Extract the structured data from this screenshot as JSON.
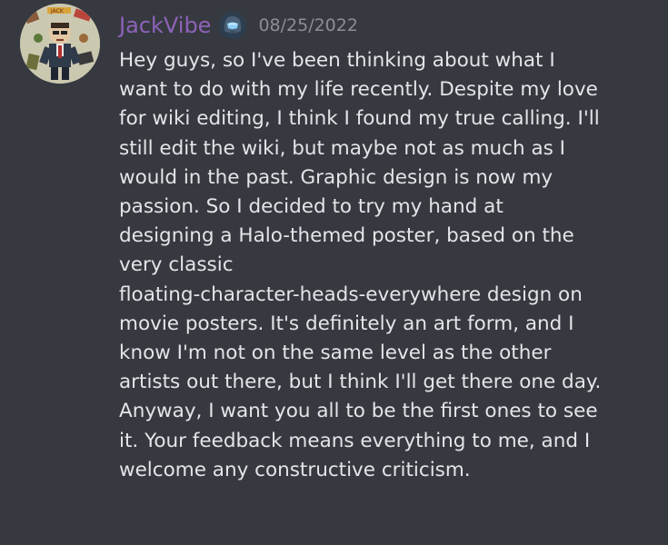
{
  "message": {
    "author": "JackVibe",
    "timestamp": "08/25/2022",
    "role_icon": "helmet-badge-icon",
    "colors": {
      "background": "#36393f",
      "username": "#8e62b8",
      "timestamp": "#8b8e93",
      "text": "#e3e5e8"
    },
    "lines": [
      "Hey guys, so I've been thinking about what I",
      "want to do with my life recently. Despite my love",
      "for wiki editing, I think I found my true calling. I'll",
      "still edit the wiki, but maybe not as much as I",
      "would in the past. Graphic design is now my",
      "passion. So I decided to try my hand at",
      "designing a Halo-themed poster, based on the",
      "very classic",
      "floating-character-heads-everywhere design on",
      "movie posters. It's definitely an art form, and I",
      "know I'm not on the same level as the other",
      "artists out there, but I think I'll get there one day.",
      "Anyway, I want you all to be the first ones to see",
      "it. Your feedback means everything to me, and I",
      "welcome any constructive criticism."
    ]
  }
}
